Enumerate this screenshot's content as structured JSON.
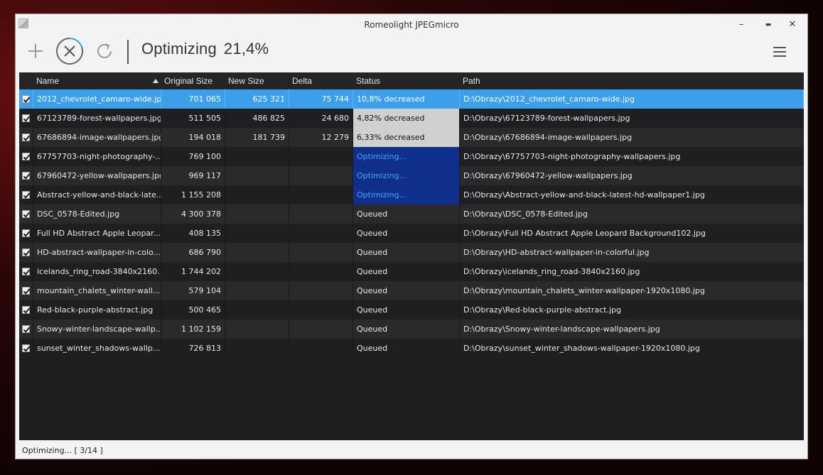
{
  "window": {
    "title": "Romeolight JPEGmicro",
    "minimize": "–",
    "maximize": "▬",
    "close": "✕"
  },
  "toolbar": {
    "status_label": "Optimizing",
    "progress": "21,4%",
    "icons": {
      "add": "plus-icon",
      "cancel": "close-circle-icon",
      "refresh": "refresh-icon",
      "menu": "hamburger-menu-icon"
    }
  },
  "grid": {
    "columns": [
      "Name",
      "Original Size",
      "New Size",
      "Delta",
      "Status",
      "Path"
    ],
    "sort_column": "Name",
    "rows": [
      {
        "name": "2012_chevrolet_camaro-wide.jpg",
        "original": "701 065",
        "new": "625 321",
        "delta": "75 744",
        "status": "10,8% decreased",
        "path": "D:\\Obrazy\\2012_chevrolet_camaro-wide.jpg",
        "state": "decreased",
        "selected": true
      },
      {
        "name": "67123789-forest-wallpapers.jpg",
        "original": "511 505",
        "new": "486 825",
        "delta": "24 680",
        "status": "4,82% decreased",
        "path": "D:\\Obrazy\\67123789-forest-wallpapers.jpg",
        "state": "decreased"
      },
      {
        "name": "67686894-image-wallpapers.jpg",
        "original": "194 018",
        "new": "181 739",
        "delta": "12 279",
        "status": "6,33% decreased",
        "path": "D:\\Obrazy\\67686894-image-wallpapers.jpg",
        "state": "decreased"
      },
      {
        "name": "67757703-night-photography-...",
        "original": "769 100",
        "new": "",
        "delta": "",
        "status": "Optimizing...",
        "path": "D:\\Obrazy\\67757703-night-photography-wallpapers.jpg",
        "state": "optimizing"
      },
      {
        "name": "67960472-yellow-wallpapers.jpg",
        "original": "969 117",
        "new": "",
        "delta": "",
        "status": "Optimizing...",
        "path": "D:\\Obrazy\\67960472-yellow-wallpapers.jpg",
        "state": "optimizing"
      },
      {
        "name": "Abstract-yellow-and-black-late...",
        "original": "1 155 208",
        "new": "",
        "delta": "",
        "status": "Optimizing...",
        "path": "D:\\Obrazy\\Abstract-yellow-and-black-latest-hd-wallpaper1.jpg",
        "state": "optimizing"
      },
      {
        "name": "DSC_0578-Edited.jpg",
        "original": "4 300 378",
        "new": "",
        "delta": "",
        "status": "Queued",
        "path": "D:\\Obrazy\\DSC_0578-Edited.jpg",
        "state": "queued"
      },
      {
        "name": "Full HD Abstract Apple Leopar...",
        "original": "408 135",
        "new": "",
        "delta": "",
        "status": "Queued",
        "path": "D:\\Obrazy\\Full HD Abstract Apple Leopard Background102.jpg",
        "state": "queued"
      },
      {
        "name": "HD-abstract-wallpaper-in-colo...",
        "original": "686 790",
        "new": "",
        "delta": "",
        "status": "Queued",
        "path": "D:\\Obrazy\\HD-abstract-wallpaper-in-colorful.jpg",
        "state": "queued"
      },
      {
        "name": "icelands_ring_road-3840x2160....",
        "original": "1 744 202",
        "new": "",
        "delta": "",
        "status": "Queued",
        "path": "D:\\Obrazy\\icelands_ring_road-3840x2160.jpg",
        "state": "queued"
      },
      {
        "name": "mountain_chalets_winter-wall...",
        "original": "579 104",
        "new": "",
        "delta": "",
        "status": "Queued",
        "path": "D:\\Obrazy\\mountain_chalets_winter-wallpaper-1920x1080.jpg",
        "state": "queued"
      },
      {
        "name": "Red-black-purple-abstract.jpg",
        "original": "500 465",
        "new": "",
        "delta": "",
        "status": "Queued",
        "path": "D:\\Obrazy\\Red-black-purple-abstract.jpg",
        "state": "queued"
      },
      {
        "name": "Snowy-winter-landscape-wallp...",
        "original": "1 102 159",
        "new": "",
        "delta": "",
        "status": "Queued",
        "path": "D:\\Obrazy\\Snowy-winter-landscape-wallpapers.jpg",
        "state": "queued"
      },
      {
        "name": "sunset_winter_shadows-wallp...",
        "original": "726 813",
        "new": "",
        "delta": "",
        "status": "Queued",
        "path": "D:\\Obrazy\\sunset_winter_shadows-wallpaper-1920x1080.jpg",
        "state": "queued"
      }
    ]
  },
  "statusbar": {
    "text": "Optimizing... [ 3/14 ]"
  },
  "colors": {
    "selected_row": "#3b9fea",
    "optimizing_bg": "#0f2f8a",
    "optimizing_text": "#4aa3ff",
    "decreased_bg": "#d0d0d0",
    "grid_bg": "#1e1e20"
  }
}
